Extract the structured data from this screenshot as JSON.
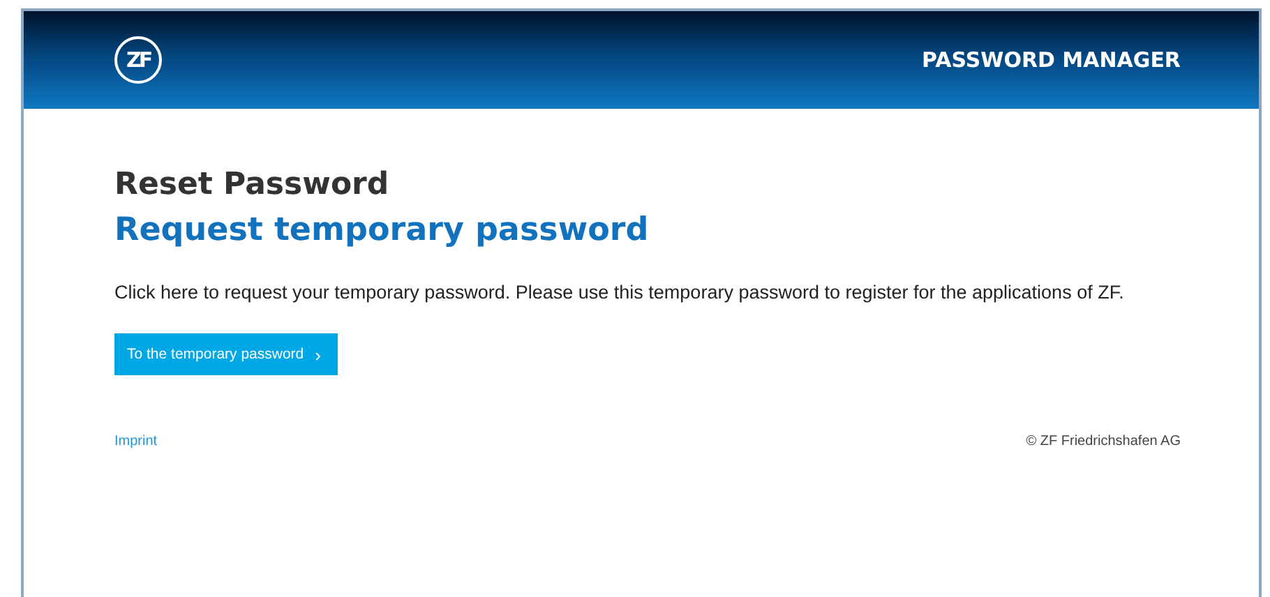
{
  "header": {
    "logo_text": "ZF",
    "title": "PASSWORD MANAGER"
  },
  "heading": "Reset Password",
  "subheading": "Request temporary password",
  "description": "Click here to request your temporary password. Please use this temporary password to register for the applications of ZF.",
  "button": {
    "label": "To the temporary password",
    "chevron": "›"
  },
  "footer": {
    "link": "Imprint",
    "copyright": "© ZF Friedrichshafen AG"
  }
}
